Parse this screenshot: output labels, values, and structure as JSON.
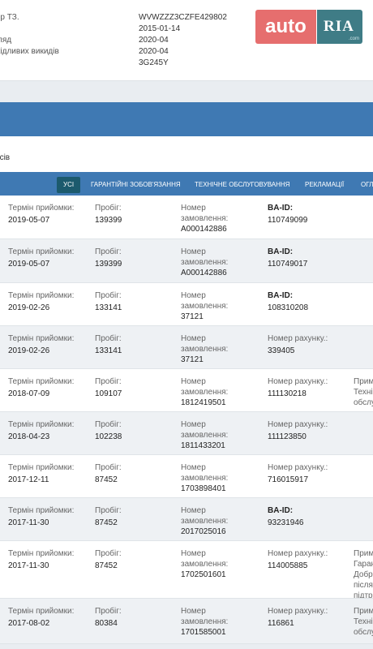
{
  "vehicle": {
    "rows": [
      {
        "label": "мер ТЗ.",
        "value": "WVWZZZ3CZFE429802"
      },
      {
        "label": "",
        "value": "2015-01-14"
      },
      {
        "label": "огляд",
        "value": "2020-04"
      },
      {
        "label": "шкідливих викидів",
        "value": "2020-04"
      },
      {
        "label": "",
        "value": "3G245Y"
      }
    ]
  },
  "logo": {
    "auto": "auto",
    "ria": "RIA",
    "com": ".com"
  },
  "section_title": "исів",
  "tabs": [
    "УСІ",
    "ГАРАНТІЙНІ ЗОБОВ'ЯЗАННЯ",
    "ТЕХНІЧНЕ ОБСЛУГОВУВАННЯ",
    "РЕКЛАМАЦІЇ",
    "ОГЛ"
  ],
  "colors": {
    "blue_bar": "#3f79b3",
    "active_tab": "#1c5a6d",
    "logo_auto": "#e66e6e",
    "logo_ria": "#3f7c86"
  },
  "records": [
    {
      "date_label": "Термін прийомки:",
      "date": "2019-05-07",
      "mileage_label": "Пробіг:",
      "mileage": "139399",
      "order_label": [
        "Номер",
        "замовлення:"
      ],
      "order": "A000142886",
      "id_label": "BA-ID:",
      "id": "110749099",
      "note": []
    },
    {
      "date_label": "Термін прийомки:",
      "date": "2019-05-07",
      "mileage_label": "Пробіг:",
      "mileage": "139399",
      "order_label": [
        "Номер",
        "замовлення:"
      ],
      "order": "A000142886",
      "id_label": "BA-ID:",
      "id": "110749017",
      "note": []
    },
    {
      "date_label": "Термін прийомки:",
      "date": "2019-02-26",
      "mileage_label": "Пробіг:",
      "mileage": "133141",
      "order_label": [
        "Номер",
        "замовлення:"
      ],
      "order": "37121",
      "id_label": "BA-ID:",
      "id": "108310208",
      "note": []
    },
    {
      "date_label": "Термін прийомки:",
      "date": "2019-02-26",
      "mileage_label": "Пробіг:",
      "mileage": "133141",
      "order_label": [
        "Номер",
        "замовлення:"
      ],
      "order": "37121",
      "id_label": "Номер рахунку.:",
      "id": "339405",
      "note": []
    },
    {
      "date_label": "Термін прийомки:",
      "date": "2018-07-09",
      "mileage_label": "Пробіг:",
      "mileage": "109107",
      "order_label": [
        "Номер",
        "замовлення:"
      ],
      "order": "1812419501",
      "id_label": "Номер рахунку.:",
      "id": "111130218",
      "note": [
        "Прим",
        "Техні",
        "обслу"
      ]
    },
    {
      "date_label": "Термін прийомки:",
      "date": "2018-04-23",
      "mileage_label": "Пробіг:",
      "mileage": "102238",
      "order_label": [
        "Номер",
        "замовлення:"
      ],
      "order": "1811433201",
      "id_label": "Номер рахунку.:",
      "id": "111123850",
      "note": []
    },
    {
      "date_label": "Термін прийомки:",
      "date": "2017-12-11",
      "mileage_label": "Пробіг:",
      "mileage": "87452",
      "order_label": [
        "Номер",
        "замовлення:"
      ],
      "order": "1703898401",
      "id_label": "Номер рахунку.:",
      "id": "716015917",
      "note": []
    },
    {
      "date_label": "Термін прийомки:",
      "date": "2017-11-30",
      "mileage_label": "Пробіг:",
      "mileage": "87452",
      "order_label": [
        "Номер",
        "замовлення:"
      ],
      "order": "2017025016",
      "id_label": "BA-ID:",
      "id": "93231946",
      "note": []
    },
    {
      "date_label": "Термін прийомки:",
      "date": "2017-11-30",
      "mileage_label": "Пробіг:",
      "mileage": "87452",
      "order_label": [
        "Номер",
        "замовлення:"
      ],
      "order": "1702501601",
      "id_label": "Номер рахунку.:",
      "id": "114005885",
      "note": [
        "Прим",
        "Гаран",
        "Добр",
        "після",
        "підтр"
      ]
    },
    {
      "date_label": "Термін прийомки:",
      "date": "2017-08-02",
      "mileage_label": "Пробіг:",
      "mileage": "80384",
      "order_label": [
        "Номер",
        "замовлення:"
      ],
      "order": "1701585001",
      "id_label": "Номер рахунку.:",
      "id": "116861",
      "note": [
        "Прим",
        "Техні",
        "обслу"
      ]
    }
  ]
}
